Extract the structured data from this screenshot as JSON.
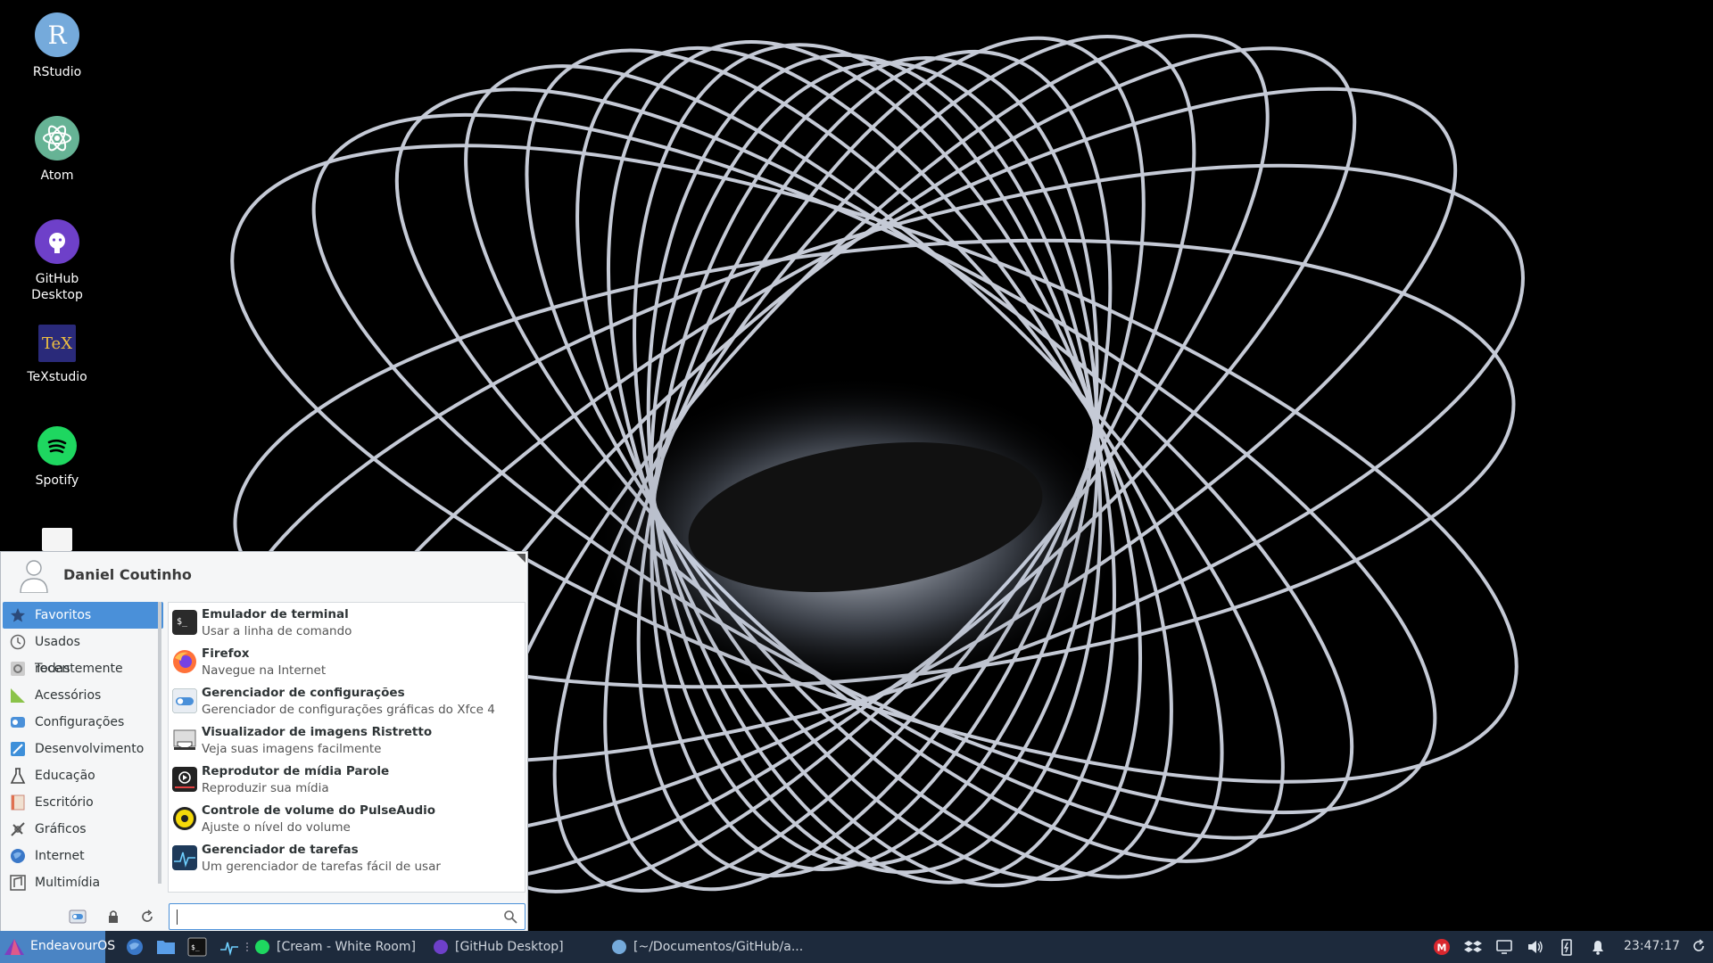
{
  "desktop": {
    "icons": [
      {
        "label": "RStudio",
        "icon": "rstudio-icon"
      },
      {
        "label": "Atom",
        "icon": "atom-icon"
      },
      {
        "label": "GitHub Desktop",
        "icon": "github-desktop-icon"
      },
      {
        "label": "TeXstudio",
        "icon": "texstudio-icon"
      },
      {
        "label": "Spotify",
        "icon": "spotify-icon"
      },
      {
        "label": "",
        "icon": "document-icon"
      }
    ]
  },
  "menu": {
    "user_name": "Daniel Coutinho",
    "categories": [
      {
        "label": "Favoritos",
        "icon": "star-icon",
        "active": true
      },
      {
        "label": "Usados recentemente",
        "icon": "clock-icon"
      },
      {
        "label": "Todas",
        "icon": "gear-icon"
      },
      {
        "label": "Acessórios",
        "icon": "accessories-icon"
      },
      {
        "label": "Configurações",
        "icon": "settings-icon"
      },
      {
        "label": "Desenvolvimento",
        "icon": "development-icon"
      },
      {
        "label": "Educação",
        "icon": "flask-icon"
      },
      {
        "label": "Escritório",
        "icon": "office-icon"
      },
      {
        "label": "Gráficos",
        "icon": "graphics-icon"
      },
      {
        "label": "Internet",
        "icon": "globe-icon"
      },
      {
        "label": "Multimídia",
        "icon": "multimedia-icon"
      }
    ],
    "apps": [
      {
        "title": "Emulador de terminal",
        "desc": "Usar a linha de comando",
        "icon": "terminal-icon"
      },
      {
        "title": "Firefox",
        "desc": "Navegue na Internet",
        "icon": "firefox-icon"
      },
      {
        "title": "Gerenciador de configurações",
        "desc": "Gerenciador de configurações gráficas do Xfce 4",
        "icon": "settings-manager-icon"
      },
      {
        "title": "Visualizador de imagens Ristretto",
        "desc": "Veja suas imagens facilmente",
        "icon": "image-viewer-icon"
      },
      {
        "title": "Reprodutor de mídia Parole",
        "desc": "Reproduzir sua mídia",
        "icon": "media-player-icon"
      },
      {
        "title": "Controle de volume do PulseAudio",
        "desc": "Ajuste o nível do volume",
        "icon": "volume-control-icon"
      },
      {
        "title": "Gerenciador de tarefas",
        "desc": "Um gerenciador de tarefas fácil de usar",
        "icon": "task-manager-icon"
      }
    ],
    "search": {
      "value": "",
      "placeholder": ""
    }
  },
  "panel": {
    "start_label": "EndeavourOS",
    "tasks": [
      {
        "label": "[Cream - White Room]",
        "icon": "spotify-icon"
      },
      {
        "label": "[GitHub Desktop]",
        "icon": "github-desktop-icon"
      },
      {
        "label": "[~/Documentos/GitHub/a...",
        "icon": "rstudio-icon"
      }
    ],
    "clock": "23:47:17"
  },
  "colors": {
    "panel_bg": "#1d2a3c",
    "accent": "#4a90d9",
    "start_bg": "#4a84c4"
  }
}
